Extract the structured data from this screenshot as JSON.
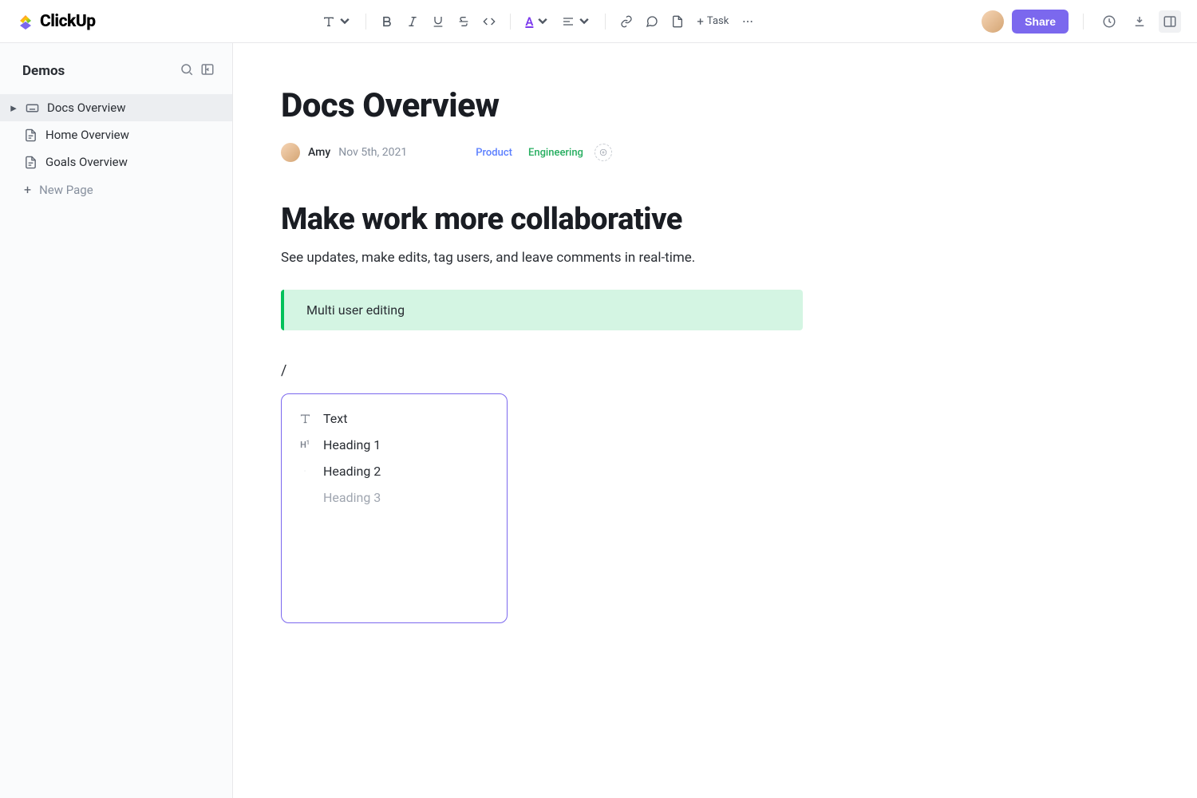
{
  "brand": "ClickUp",
  "toolbar": {
    "task_label": "Task",
    "share_label": "Share"
  },
  "sidebar": {
    "title": "Demos",
    "items": [
      {
        "label": "Docs Overview",
        "active": true,
        "icon": "keyboard"
      },
      {
        "label": "Home Overview",
        "active": false,
        "icon": "doc"
      },
      {
        "label": "Goals Overview",
        "active": false,
        "icon": "doc"
      }
    ],
    "new_page_label": "New Page"
  },
  "doc": {
    "title": "Docs Overview",
    "author": "Amy",
    "date": "Nov 5th, 2021",
    "tags": [
      {
        "label": "Product",
        "cls": "product"
      },
      {
        "label": "Engineering",
        "cls": "eng"
      }
    ],
    "heading": "Make work more collaborative",
    "body": "See updates, make edits, tag users, and leave comments in real-time.",
    "callout": "Multi user editing",
    "slash": "/"
  },
  "popup": {
    "items": [
      {
        "label": "Text",
        "icon": "T"
      },
      {
        "label": "Heading 1",
        "icon": "H1"
      },
      {
        "label": "Heading 2",
        "icon": "H2"
      },
      {
        "label": "Heading 3",
        "icon": "",
        "muted": true
      }
    ]
  }
}
